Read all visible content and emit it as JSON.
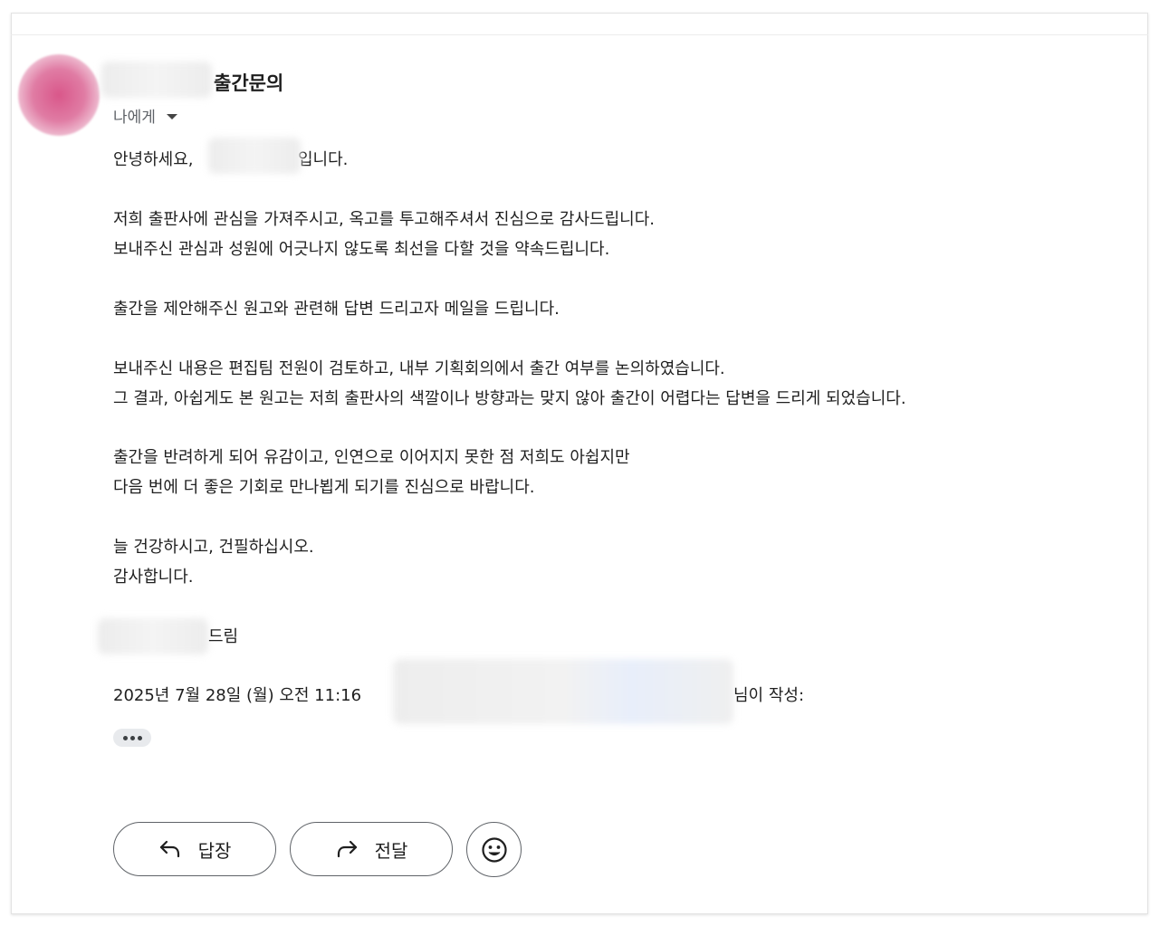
{
  "header": {
    "subject": "출간문의",
    "recipient_label": "나에게"
  },
  "body": {
    "greeting_prefix": "안녕하세요,",
    "greeting_suffix": "입니다.",
    "lines": [
      "저희 출판사에 관심을 가져주시고, 옥고를 투고해주셔서 진심으로 감사드립니다.",
      "보내주신 관심과 성원에 어긋나지 않도록 최선을 다할 것을 약속드립니다.",
      "출간을 제안해주신 원고와 관련해 답변 드리고자 메일을 드립니다.",
      "보내주신 내용은 편집팀 전원이 검토하고, 내부 기획회의에서 출간 여부를 논의하였습니다.",
      "그 결과, 아쉽게도 본 원고는 저희 출판사의 색깔이나 방향과는 맞지 않아 출간이 어렵다는 답변을 드리게 되었습니다.",
      "출간을 반려하게 되어 유감이고, 인연으로 이어지지 못한 점 저희도 아쉽지만",
      "다음 번에 더 좋은 기회로 만나뵙게 되기를 진심으로 바랍니다.",
      "늘 건강하시고, 건필하십시오.",
      "감사합니다."
    ],
    "signature_suffix": "드림"
  },
  "quote": {
    "date_text": "2025년 7월 28일 (월) 오전 11:16",
    "suffix_text": "님이 작성:"
  },
  "actions": {
    "reply_label": "답장",
    "forward_label": "전달"
  },
  "icons": {
    "reply": "reply-arrow-icon",
    "forward": "forward-arrow-icon",
    "emoji": "smiley-face-icon",
    "more": "more-dots-icon",
    "dropdown": "caret-down-icon"
  },
  "colors": {
    "avatar": "#d9578a",
    "text": "#1f1f1f",
    "muted": "#5f6368",
    "button_border": "#5f6368"
  }
}
